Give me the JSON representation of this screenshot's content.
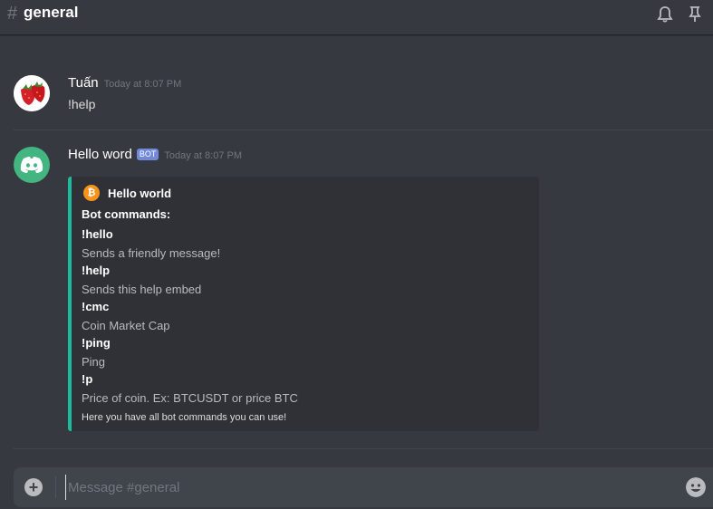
{
  "header": {
    "hash": "#",
    "channel": "general",
    "icons": [
      "bell-icon",
      "pin-icon"
    ]
  },
  "messages": [
    {
      "author": "Tuấn",
      "timestamp": "Today at 8:07 PM",
      "content": "!help",
      "avatar": "strawberry-avatar"
    },
    {
      "author": "Hello word",
      "bot_tag": "BOT",
      "timestamp": "Today at 8:07 PM",
      "avatar": "discord-logo-avatar"
    }
  ],
  "embed": {
    "accent": "#1abc9c",
    "author": "Hello world",
    "author_icon": "bitcoin-icon",
    "title": "Bot commands:",
    "fields": [
      {
        "name": "!hello",
        "value": "Sends a friendly message!"
      },
      {
        "name": "!help",
        "value": "Sends this help embed"
      },
      {
        "name": "!cmc",
        "value": "Coin Market Cap"
      },
      {
        "name": "!ping",
        "value": "Ping"
      },
      {
        "name": "!p",
        "value": "Price of coin. Ex: BTCUSDT or price BTC"
      }
    ],
    "footer": "Here you have all bot commands you can use!"
  },
  "input": {
    "placeholder": "Message #general"
  }
}
